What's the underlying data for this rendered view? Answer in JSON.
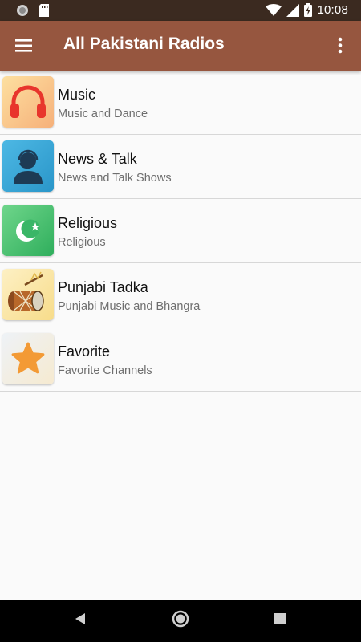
{
  "status_bar": {
    "time": "10:08",
    "icons": [
      "notification-dot-icon",
      "sd-card-icon",
      "wifi-icon",
      "signal-icon",
      "battery-charging-icon"
    ]
  },
  "app_bar": {
    "title": "All Pakistani Radios",
    "color": "#96563f",
    "icons": [
      "hamburger-menu-icon",
      "overflow-menu-icon"
    ]
  },
  "categories": [
    {
      "title": "Music",
      "subtitle": "Music and Dance",
      "icon": "headphones-icon"
    },
    {
      "title": "News & Talk",
      "subtitle": "News and Talk Shows",
      "icon": "news-anchor-icon"
    },
    {
      "title": "Religious",
      "subtitle": "Religious",
      "icon": "crescent-star-icon"
    },
    {
      "title": "Punjabi Tadka",
      "subtitle": "Punjabi Music and Bhangra",
      "icon": "dhol-drum-icon"
    },
    {
      "title": "Favorite",
      "subtitle": "Favorite Channels",
      "icon": "star-icon"
    }
  ],
  "nav_bar": {
    "icons": [
      "back-icon",
      "home-icon",
      "recents-icon"
    ]
  }
}
